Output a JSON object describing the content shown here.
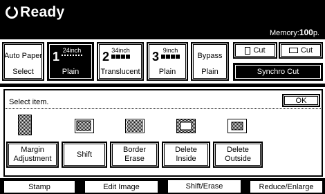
{
  "title": {
    "text": "Ready",
    "icon": "power-ring-icon"
  },
  "memory": {
    "label": "Memory:",
    "value": "100",
    "unit": "p."
  },
  "trays": [
    {
      "id": "auto",
      "label_top": "Auto Paper",
      "label_bottom": "Select"
    },
    {
      "id": "tray1",
      "number": "1",
      "size": "24inch",
      "type": "Plain",
      "selected": true
    },
    {
      "id": "tray2",
      "number": "2",
      "size": "34inch",
      "type": "Translucent"
    },
    {
      "id": "tray3",
      "number": "3",
      "size": "9inch",
      "type": "Plain"
    },
    {
      "id": "bypass",
      "label_top": "Bypass",
      "label_bottom": "Plain"
    }
  ],
  "cut": {
    "cut1_label": "Cut",
    "cut2_label": "Cut",
    "synchro_label": "Synchro Cut"
  },
  "panel": {
    "prompt": "Select item.",
    "ok_label": "OK",
    "items": [
      {
        "label": "Margin\nAdjustment",
        "icon": "margin-adjustment-icon"
      },
      {
        "label": "Shift",
        "icon": "shift-icon"
      },
      {
        "label": "Border\nErase",
        "icon": "border-erase-icon"
      },
      {
        "label": "Delete\nInside",
        "icon": "delete-inside-icon"
      },
      {
        "label": "Delete\nOutside",
        "icon": "delete-outside-icon"
      }
    ]
  },
  "tabs": [
    {
      "label": "Stamp"
    },
    {
      "label": "Edit Image"
    },
    {
      "label": "Shift/Erase",
      "active": true
    },
    {
      "label": "Reduce/Enlarge"
    }
  ],
  "colors": {
    "background": "#ffffff",
    "foreground": "#000000",
    "hatch": "#7a7a7a"
  }
}
